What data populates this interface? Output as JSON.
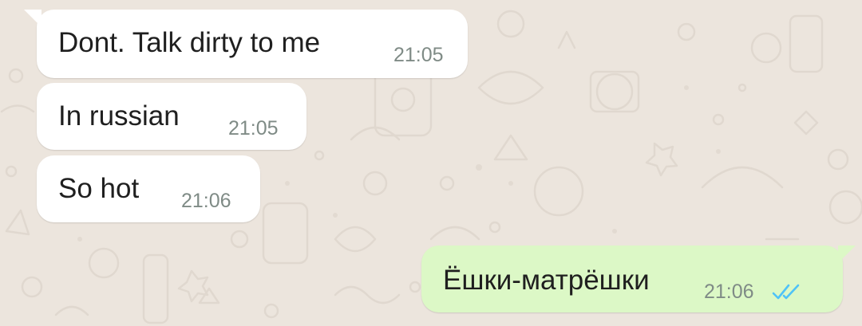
{
  "messages": [
    {
      "direction": "incoming",
      "text": "Dont. Talk dirty to me",
      "time": "21:05"
    },
    {
      "direction": "incoming",
      "text": "In russian",
      "time": "21:05"
    },
    {
      "direction": "incoming",
      "text": "So hot",
      "time": "21:06"
    },
    {
      "direction": "outgoing",
      "text": "Ёшки-матрёшки",
      "time": "21:06",
      "status": "read"
    }
  ],
  "colors": {
    "background": "#ece5dd",
    "incoming_bubble": "#ffffff",
    "outgoing_bubble": "#dcf8c6",
    "read_ticks": "#4fc3f7",
    "time_text": "#7f8b86"
  },
  "icons": {
    "read_status": "double-check-icon"
  }
}
